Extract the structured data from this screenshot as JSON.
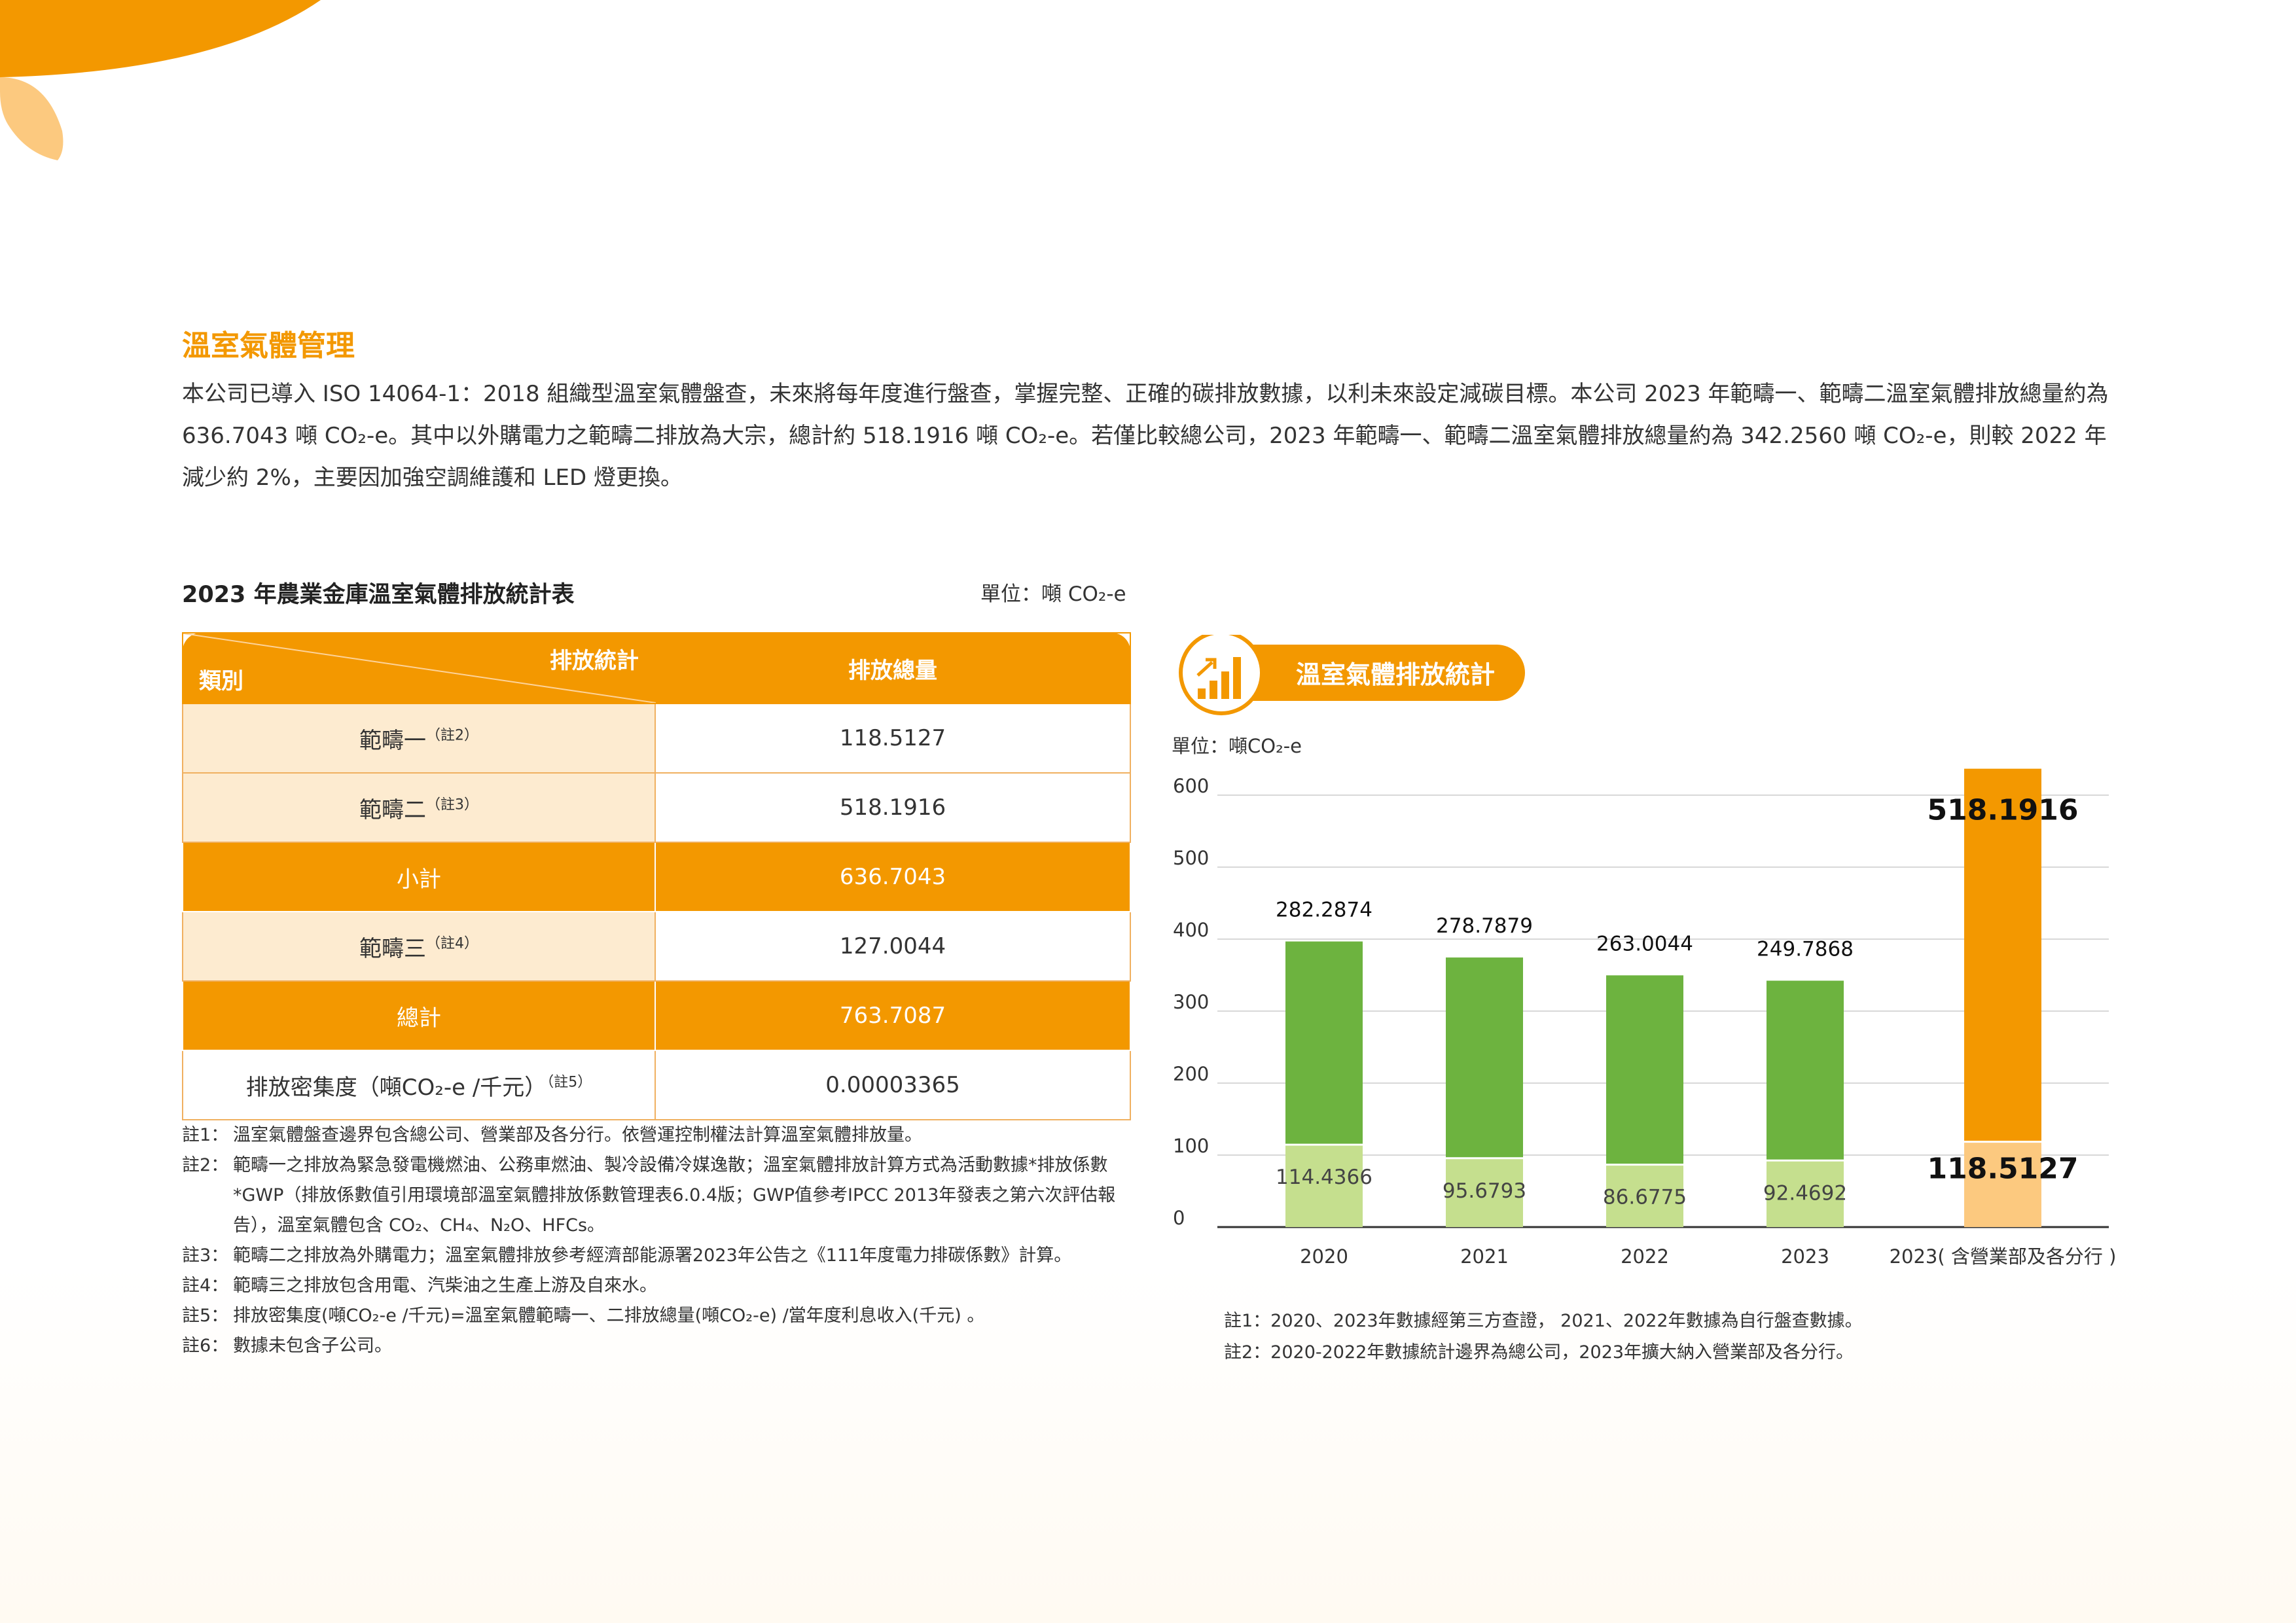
{
  "colors": {
    "accent": "#f39800",
    "green": "#6db33f",
    "light_green": "#c5df8e",
    "light_orange": "#fcc97f",
    "cell_bg": "#fdebd0"
  },
  "section_title": "溫室氣體管理",
  "intro": "本公司已導入 ISO 14064-1：2018 組織型溫室氣體盤查，未來將每年度進行盤查，掌握完整、正確的碳排放數據，以利未來設定減碳目標。本公司 2023 年範疇一、範疇二溫室氣體排放總量約為 636.7043 噸 CO₂-e。其中以外購電力之範疇二排放為大宗，總計約 518.1916 噸 CO₂-e。若僅比較總公司，2023 年範疇一、範疇二溫室氣體排放總量約為 342.2560 噸 CO₂-e，則較 2022 年減少約 2%，主要因加強空調維護和 LED 燈更換。",
  "table": {
    "title": "2023 年農業金庫溫室氣體排放統計表",
    "unit": "單位：噸 CO₂-e",
    "header_top": "排放統計",
    "header_bottom": "類別",
    "header_value": "排放總量",
    "rows": [
      {
        "label": "範疇一",
        "note": "（註2）",
        "value": "118.5127"
      },
      {
        "label": "範疇二",
        "note": "（註3）",
        "value": "518.1916"
      },
      {
        "label": "小計",
        "note": "",
        "value": "636.7043"
      },
      {
        "label": "範疇三",
        "note": "（註4）",
        "value": "127.0044"
      },
      {
        "label": "總計",
        "note": "",
        "value": "763.7087"
      },
      {
        "label": "排放密集度（噸CO₂-e /千元）",
        "note": "（註5）",
        "value": "0.00003365"
      }
    ]
  },
  "table_notes": [
    {
      "key": "註1：",
      "text": "溫室氣體盤查邊界包含總公司、營業部及各分行。依營運控制權法計算溫室氣體排放量。"
    },
    {
      "key": "註2：",
      "text": "範疇一之排放為緊急發電機燃油、公務車燃油、製冷設備冷媒逸散；溫室氣體排放計算方式為活動數據*排放係數*GWP（排放係數值引用環境部溫室氣體排放係數管理表6.0.4版；GWP值參考IPCC 2013年發表之第六次評估報告），溫室氣體包含 CO₂、CH₄、N₂O、HFCs。"
    },
    {
      "key": "註3：",
      "text": "範疇二之排放為外購電力；溫室氣體排放參考經濟部能源署2023年公告之《111年度電力排碳係數》計算。"
    },
    {
      "key": "註4：",
      "text": "範疇三之排放包含用電、汽柴油之生產上游及自來水。"
    },
    {
      "key": "註5：",
      "text": "排放密集度(噸CO₂-e /千元)=溫室氣體範疇一、二排放總量(噸CO₂-e) /當年度利息收入(千元) 。"
    },
    {
      "key": "註6：",
      "text": "數據未包含子公司。"
    }
  ],
  "chart_title": "溫室氣體排放統計",
  "chart_data": {
    "type": "bar",
    "stacked": true,
    "unit_label": "單位：噸CO₂-e",
    "categories": [
      "2020",
      "2021",
      "2022",
      "2023",
      "2023( 含營業部及各分行 )"
    ],
    "series": [
      {
        "values": [
          114.4366,
          95.6793,
          86.6775,
          92.4692,
          118.5127
        ]
      },
      {
        "values": [
          282.2874,
          278.7879,
          263.0044,
          249.7868,
          518.1916
        ]
      }
    ],
    "ylim": [
      0,
      600
    ],
    "yticks": [
      0,
      100,
      200,
      300,
      400,
      500,
      600
    ],
    "grid": true
  },
  "chart_notes": [
    "註1：2020、2023年數據經第三方查證， 2021、2022年數據為自行盤查數據。",
    "註2：2020-2022年數據統計邊界為總公司，2023年擴大納入營業部及各分行。"
  ]
}
